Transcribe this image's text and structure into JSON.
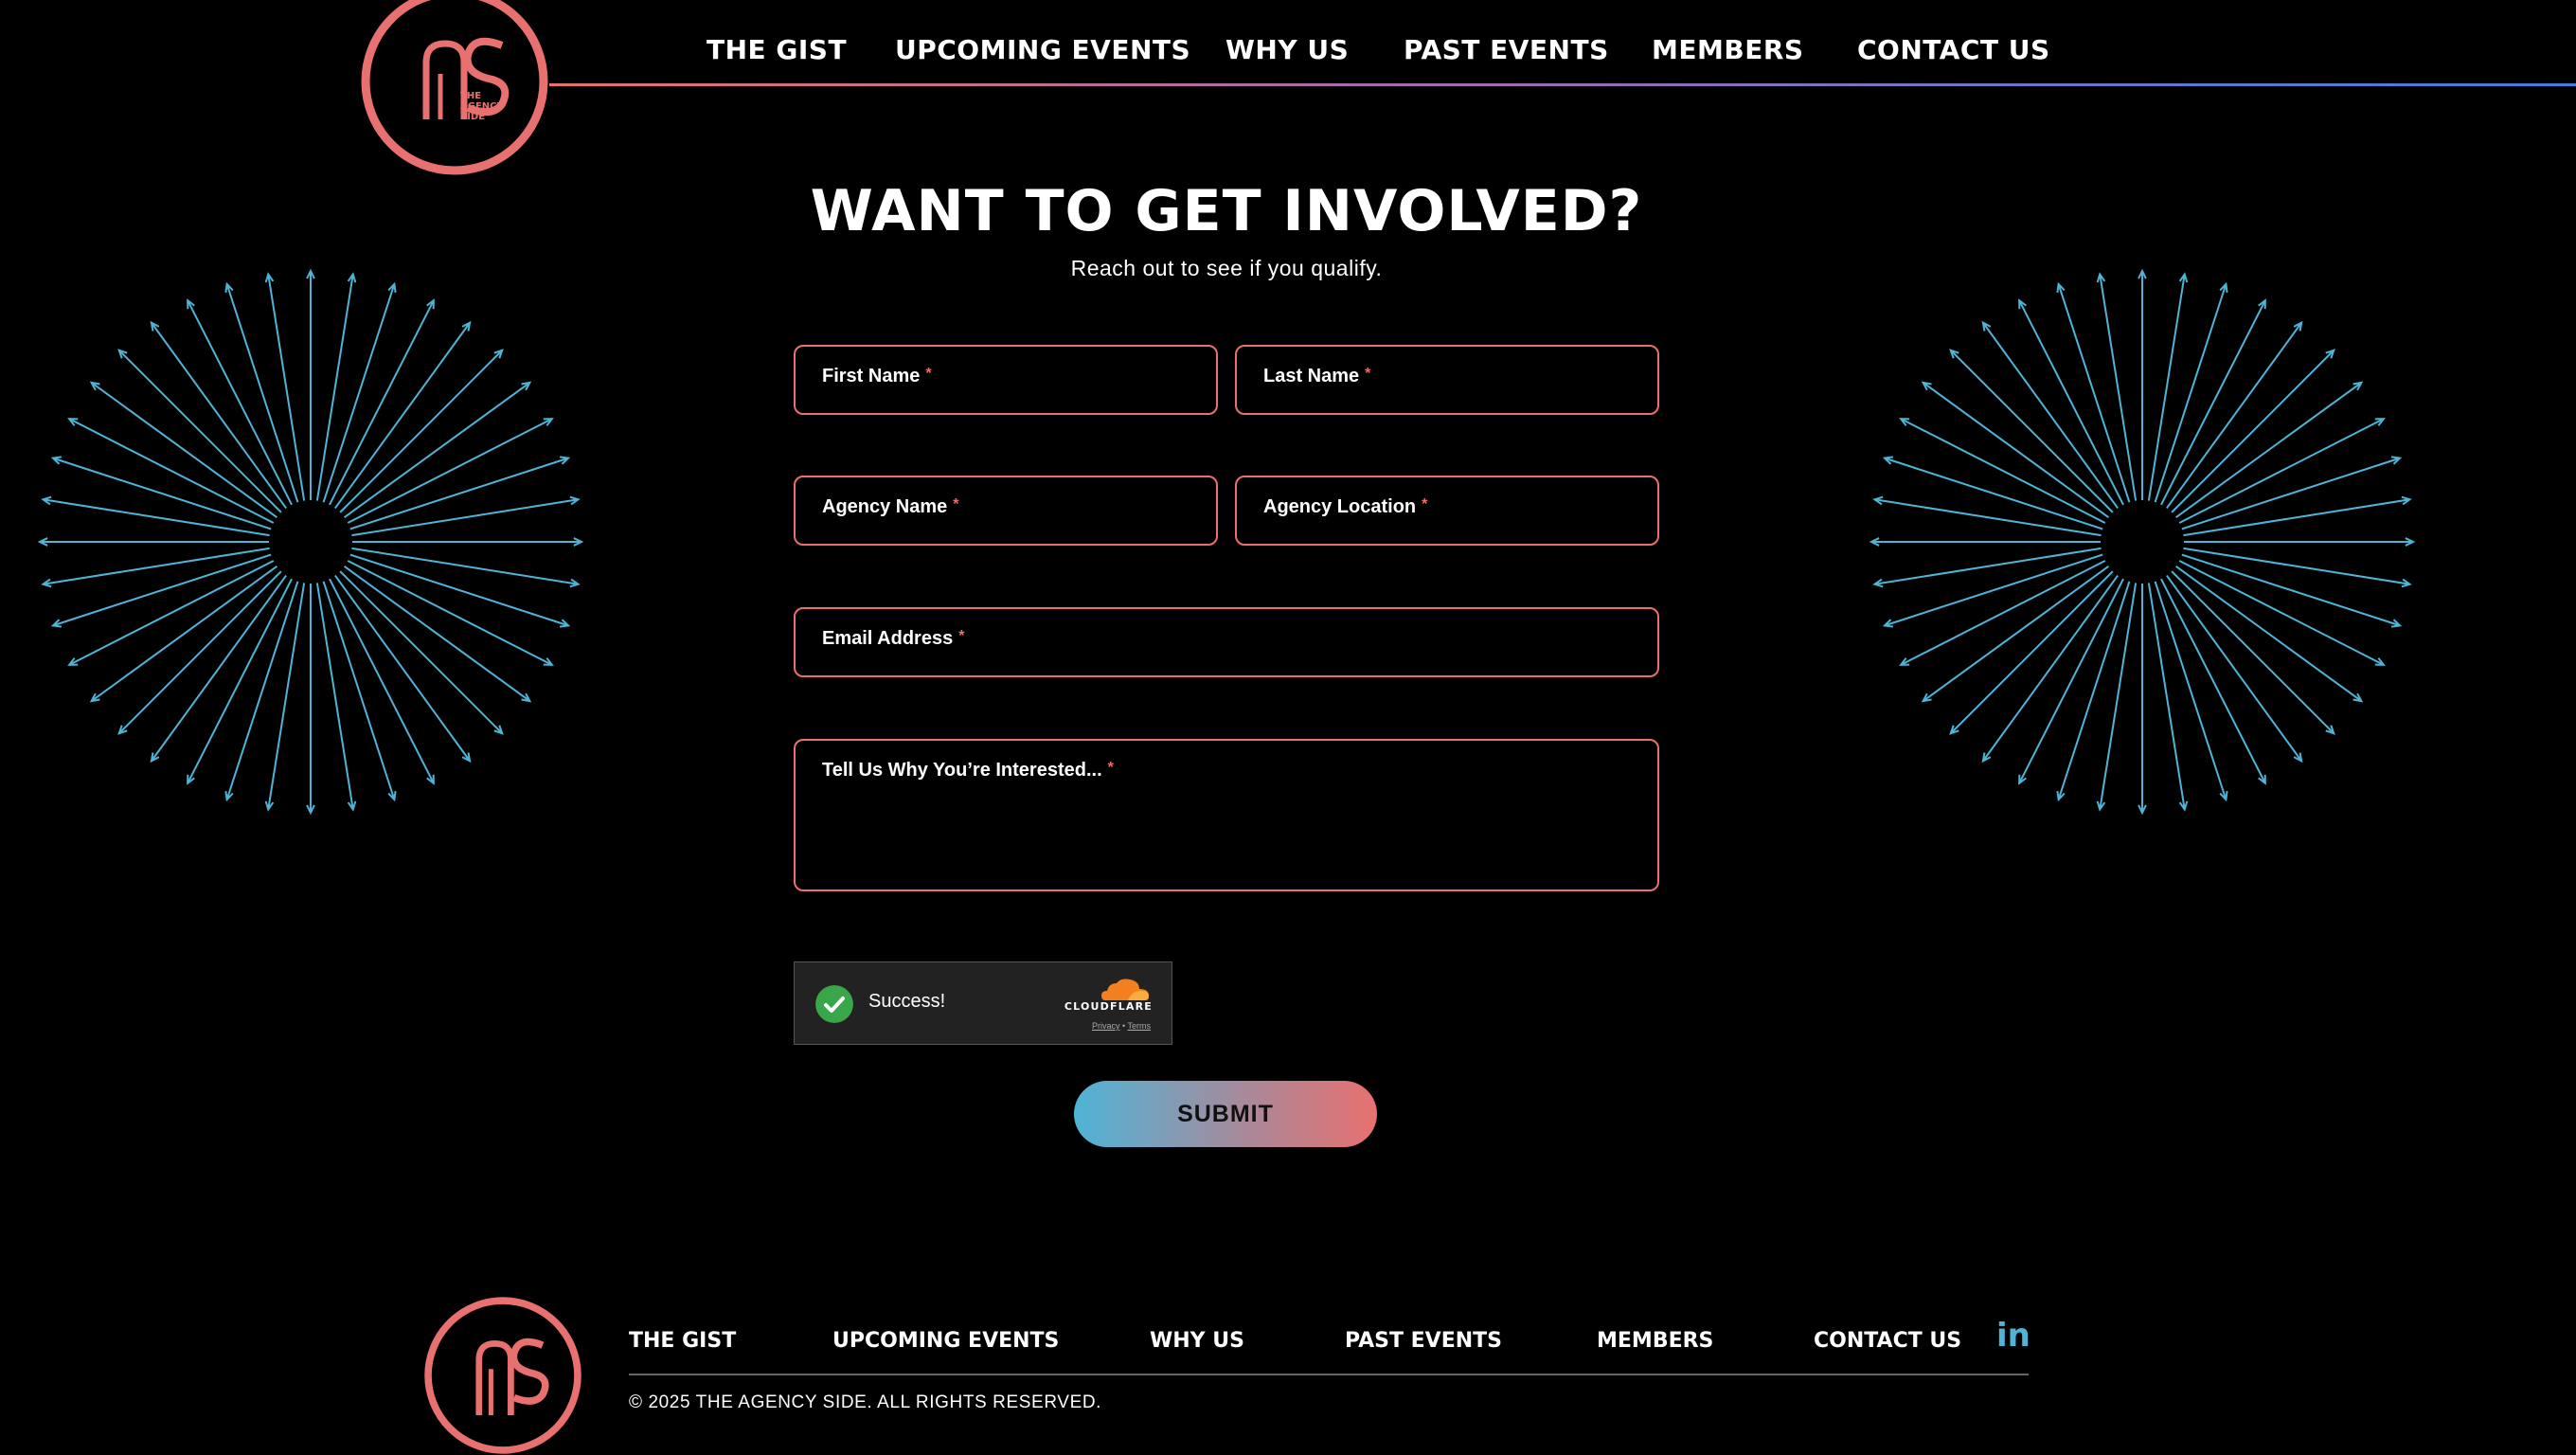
{
  "header": {
    "logo_text": "THE AGENCY SIDE",
    "nav": [
      "THE GIST",
      "UPCOMING EVENTS",
      "WHY US",
      "PAST EVENTS",
      "MEMBERS",
      "CONTACT US"
    ]
  },
  "hero": {
    "title": "WANT TO GET INVOLVED?",
    "subtitle": "Reach out to see if you qualify."
  },
  "form": {
    "required_mark": "*",
    "first_name": "First Name",
    "last_name": "Last Name",
    "agency_name": "Agency Name",
    "agency_location": "Agency Location",
    "email": "Email Address",
    "message": "Tell Us Why You’re Interested...",
    "submit": "SUBMIT"
  },
  "captcha": {
    "status": "Success!",
    "brand": "CLOUDFLARE",
    "privacy": "Privacy",
    "separator": "•",
    "terms": "Terms"
  },
  "footer": {
    "nav": [
      "THE GIST",
      "UPCOMING EVENTS",
      "WHY US",
      "PAST EVENTS",
      "MEMBERS",
      "CONTACT US"
    ],
    "social": "in",
    "copyright": "© 2025 THE AGENCY SIDE. ALL RIGHTS RESERVED."
  },
  "colors": {
    "accent_coral": "#e8706f",
    "accent_blue": "#4fb4d6",
    "success_green": "#3aa64a",
    "cloudflare_orange": "#f38020"
  },
  "icons": {
    "logo": "agency-side-logo",
    "captcha_check": "check-icon",
    "cloud": "cloudflare-cloud-icon",
    "social": "linkedin-icon",
    "decor": "starburst-decoration"
  }
}
